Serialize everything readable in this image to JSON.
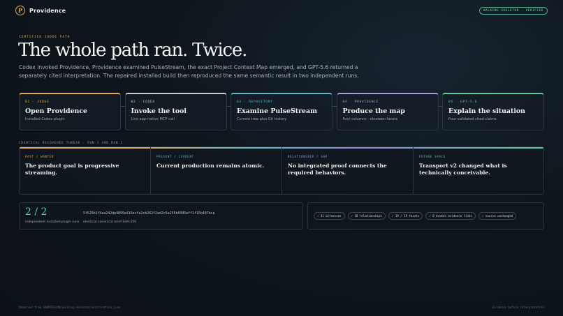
{
  "app": {
    "logo_letter": "P",
    "name": "Providence",
    "badge": "WALKING SKELETON · VERIFIED"
  },
  "hero": {
    "eyebrow": "CERTIFIED JUDGE PATH",
    "title": "The whole path ran. Twice.",
    "lede": "Codex invoked Providence, Providence examined PulseStream, the exact Project Context Map emerged, and GPT-5.6 returned a separately cited interpretation. The repaired installed build then reproduced the same semantic result in two independent runs."
  },
  "steps": [
    {
      "num": "01 · JUDGE",
      "title": "Open Providence",
      "desc": "Installed Codex plugin",
      "color": "#e0a85a"
    },
    {
      "num": "02 · CODEX",
      "title": "Invoke the tool",
      "desc": "Live app-native MCP call",
      "color": "#c9ced2"
    },
    {
      "num": "03 · REPOSITORY",
      "title": "Examine PulseStream",
      "desc": "Current tree plus Git history",
      "color": "#5fb7c7"
    },
    {
      "num": "04 · PROVIDENCE",
      "title": "Produce the map",
      "desc": "Four columns · nineteen facets",
      "color": "#a99be6"
    },
    {
      "num": "05 · GPT-5.6",
      "title": "Explain the situation",
      "desc": "Four validated cited claims",
      "color": "#5fc9a0"
    }
  ],
  "thread": {
    "label": "IDENTICAL RECOVERED THREAD · RUN 1 AND RUN 2",
    "columns": [
      {
        "label": "PAST / WANTED",
        "text": "The product goal is progressive streaming.",
        "color": "#e0a85a"
      },
      {
        "label": "PRESENT / CURRENT",
        "text": "Current production remains atomic.",
        "color": "#5fb7c7"
      },
      {
        "label": "RELATIONSHIP / GAP",
        "text": "No integrated proof connects the required behaviors.",
        "color": "#a99be6"
      },
      {
        "label": "FUTURE SPACE",
        "text": "Transport v2 changed what is technically conceivable.",
        "color": "#5fc9a0"
      }
    ]
  },
  "runs": {
    "value": "2 / 2",
    "caption": "independent installed-plugin runs",
    "hash": "5f529b1f4aa242de4895e416ecfa2cb262f2ad2c5a255b0395eff1f15b407bca",
    "hash_caption": "identical canonical brief SHA-256"
  },
  "facts": [
    "✓ 31 witnesses",
    "✓ 18 relationships",
    "✓ 19 / 19 facets",
    "✓ 0 broken evidence links",
    "✓ source unchanged"
  ],
  "footer": {
    "left": "Observed from SUBMISSION/walking-skeleton/verification.json",
    "right": "Evidence before interpretation"
  }
}
